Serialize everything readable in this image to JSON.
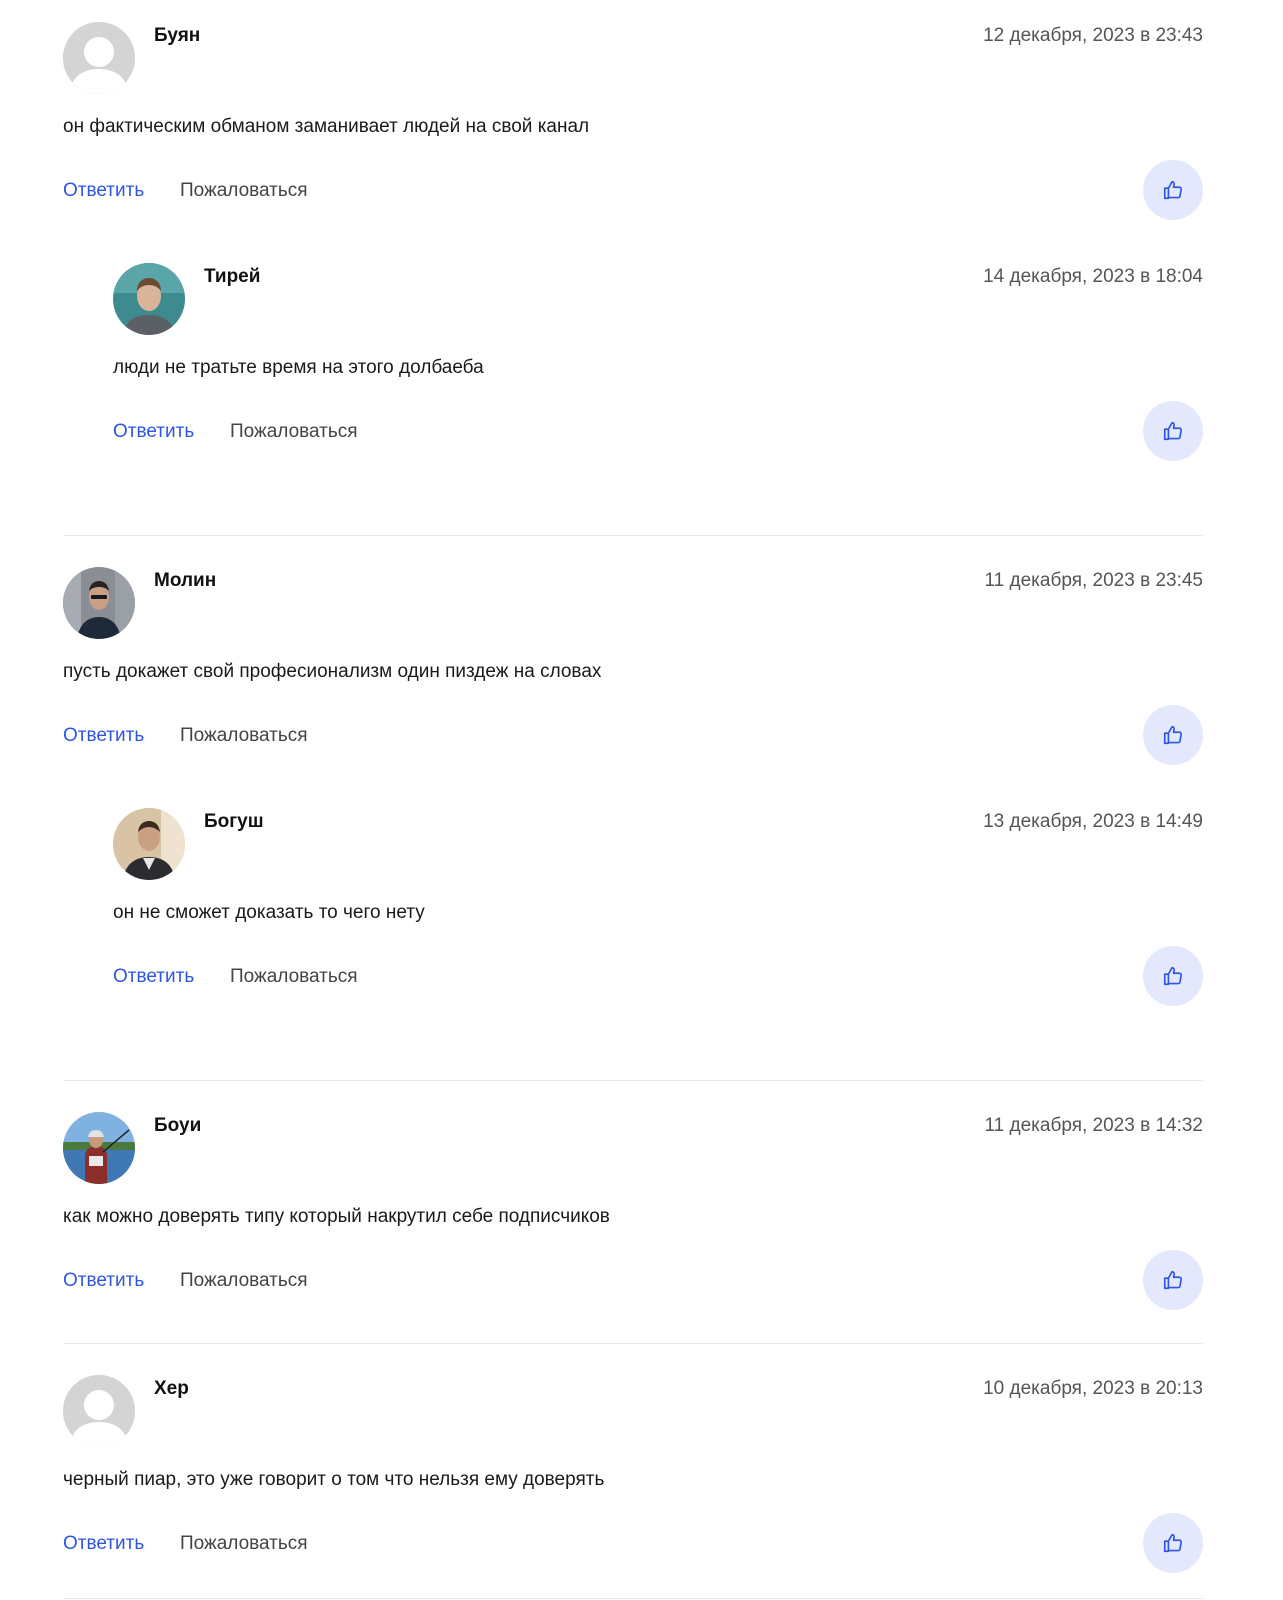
{
  "actions": {
    "reply_label": "Ответить",
    "report_label": "Пожаловаться"
  },
  "icons": {
    "like": "thumbs-up-icon",
    "default_avatar": "user-placeholder-icon"
  },
  "colors": {
    "reply_link": "#2f55e4",
    "like_bg": "#e3e8fc",
    "like_icon": "#2f55e4"
  },
  "comments": [
    {
      "author": "Буян",
      "date": "12 декабря, 2023 в 23:43",
      "text": "он фактическим обманом заманивает людей на свой канал",
      "avatar": "default",
      "replies": [
        {
          "author": "Тирей",
          "date": "14 декабря, 2023 в 18:04",
          "text": "люди не тратьте время на этого долбаеба",
          "avatar": "photo"
        }
      ]
    },
    {
      "author": "Молин",
      "date": "11 декабря, 2023 в 23:45",
      "text": "пусть докажет свой професионализм один пиздеж на словах",
      "avatar": "photo",
      "replies": [
        {
          "author": "Богуш",
          "date": "13 декабря, 2023 в 14:49",
          "text": "он не сможет доказать то чего нету",
          "avatar": "photo"
        }
      ]
    },
    {
      "author": "Боуи",
      "date": "11 декабря, 2023 в 14:32",
      "text": "как можно доверять типу который накрутил себе подписчиков",
      "avatar": "photo",
      "replies": []
    },
    {
      "author": "Хер",
      "date": "10 декабря, 2023 в 20:13",
      "text": "черный пиар, это уже говорит о том что нельзя ему доверять",
      "avatar": "default",
      "replies": []
    }
  ]
}
